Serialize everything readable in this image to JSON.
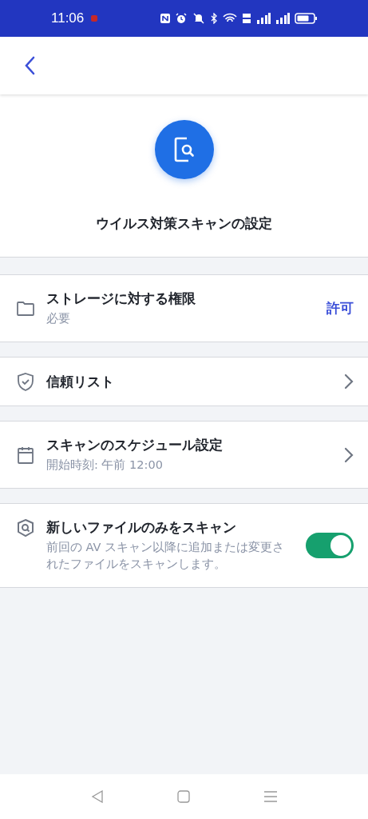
{
  "status_bar": {
    "time": "11:06"
  },
  "header": {
    "title": "ウイルス対策スキャンの設定"
  },
  "rows": [
    {
      "kind": "action",
      "title": "ストレージに対する権限",
      "subtitle": "必要",
      "action": "許可"
    },
    {
      "kind": "link",
      "title": "信頼リスト"
    },
    {
      "kind": "link",
      "title": "スキャンのスケジュール設定",
      "subtitle": "開始時刻: 午前 12:00"
    },
    {
      "kind": "toggle",
      "title": "新しいファイルのみをスキャン",
      "subtitle": "前回の AV スキャン以降に追加または変更されたファイルをスキャンします。",
      "on": true
    }
  ]
}
